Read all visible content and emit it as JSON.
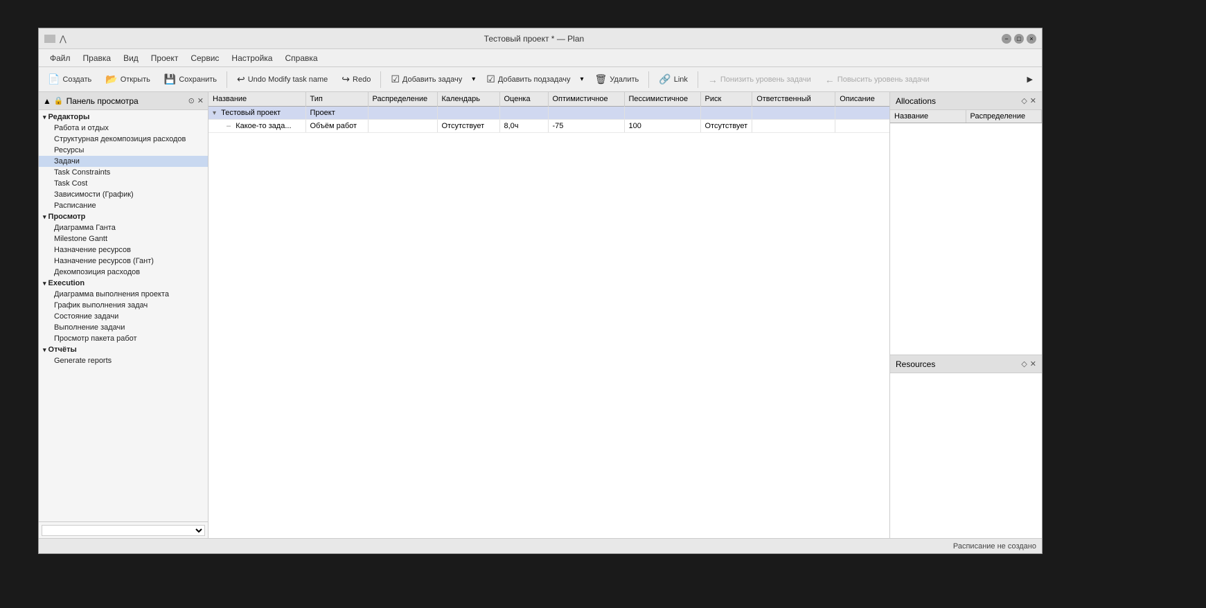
{
  "window": {
    "title": "Тестовый проект * — Plan"
  },
  "menu": {
    "items": [
      "Файл",
      "Правка",
      "Вид",
      "Проект",
      "Сервис",
      "Настройка",
      "Справка"
    ]
  },
  "toolbar": {
    "create": "Создать",
    "open": "Открыть",
    "save": "Сохранить",
    "undo": "Undo Modify task name",
    "redo": "Redo",
    "add_task": "Добавить задачу",
    "add_subtask": "Добавить подзадачу",
    "delete": "Удалить",
    "link": "Link",
    "demote": "Понизить уровень задачи",
    "promote": "Повысить уровень задачи"
  },
  "sidebar": {
    "header": "Панель просмотра",
    "groups": [
      {
        "name": "Редакторы",
        "expanded": true,
        "items": [
          "Работа и отдых",
          "Структурная декомпозиция расходов",
          "Ресурсы",
          "Задачи",
          "Task Constraints",
          "Task Cost",
          "Зависимости (График)",
          "Расписание"
        ]
      },
      {
        "name": "Просмотр",
        "expanded": true,
        "items": [
          "Диаграмма Ганта",
          "Milestone Gantt",
          "Назначение ресурсов",
          "Назначение ресурсов (Гант)",
          "Декомпозиция расходов"
        ]
      },
      {
        "name": "Execution",
        "expanded": true,
        "items": [
          "Диаграмма выполнения проекта",
          "График выполнения задач",
          "Состояние задачи",
          "Выполнение задачи",
          "Просмотр пакета работ"
        ]
      },
      {
        "name": "Отчёты",
        "expanded": true,
        "items": [
          "Generate reports"
        ]
      }
    ],
    "active_item": "Задачи"
  },
  "table": {
    "columns": [
      "Название",
      "Тип",
      "Распределение",
      "Календарь",
      "Оценка",
      "Оптимистичное",
      "Пессимистичное",
      "Риск",
      "Ответственный",
      "Описание"
    ],
    "rows": [
      {
        "id": "project",
        "name": "Тестовый проект",
        "type": "Проект",
        "distribution": "",
        "calendar": "",
        "estimate": "",
        "optimistic": "",
        "pessimistic": "",
        "risk": "",
        "responsible": "",
        "description": "",
        "is_project": true
      },
      {
        "id": "task1",
        "name": "Какое-то зада...",
        "type": "Объём работ",
        "distribution": "",
        "calendar": "Отсутствует",
        "estimate": "8,0ч",
        "optimistic": "-75",
        "pessimistic": "100",
        "risk": "Отсутствует",
        "responsible": "",
        "description": "",
        "is_project": false
      }
    ]
  },
  "allocations_panel": {
    "title": "Allocations",
    "columns": [
      "Название",
      "Распределение"
    ]
  },
  "resources_panel": {
    "title": "Resources"
  },
  "status_bar": {
    "text": "Расписание не создано"
  }
}
